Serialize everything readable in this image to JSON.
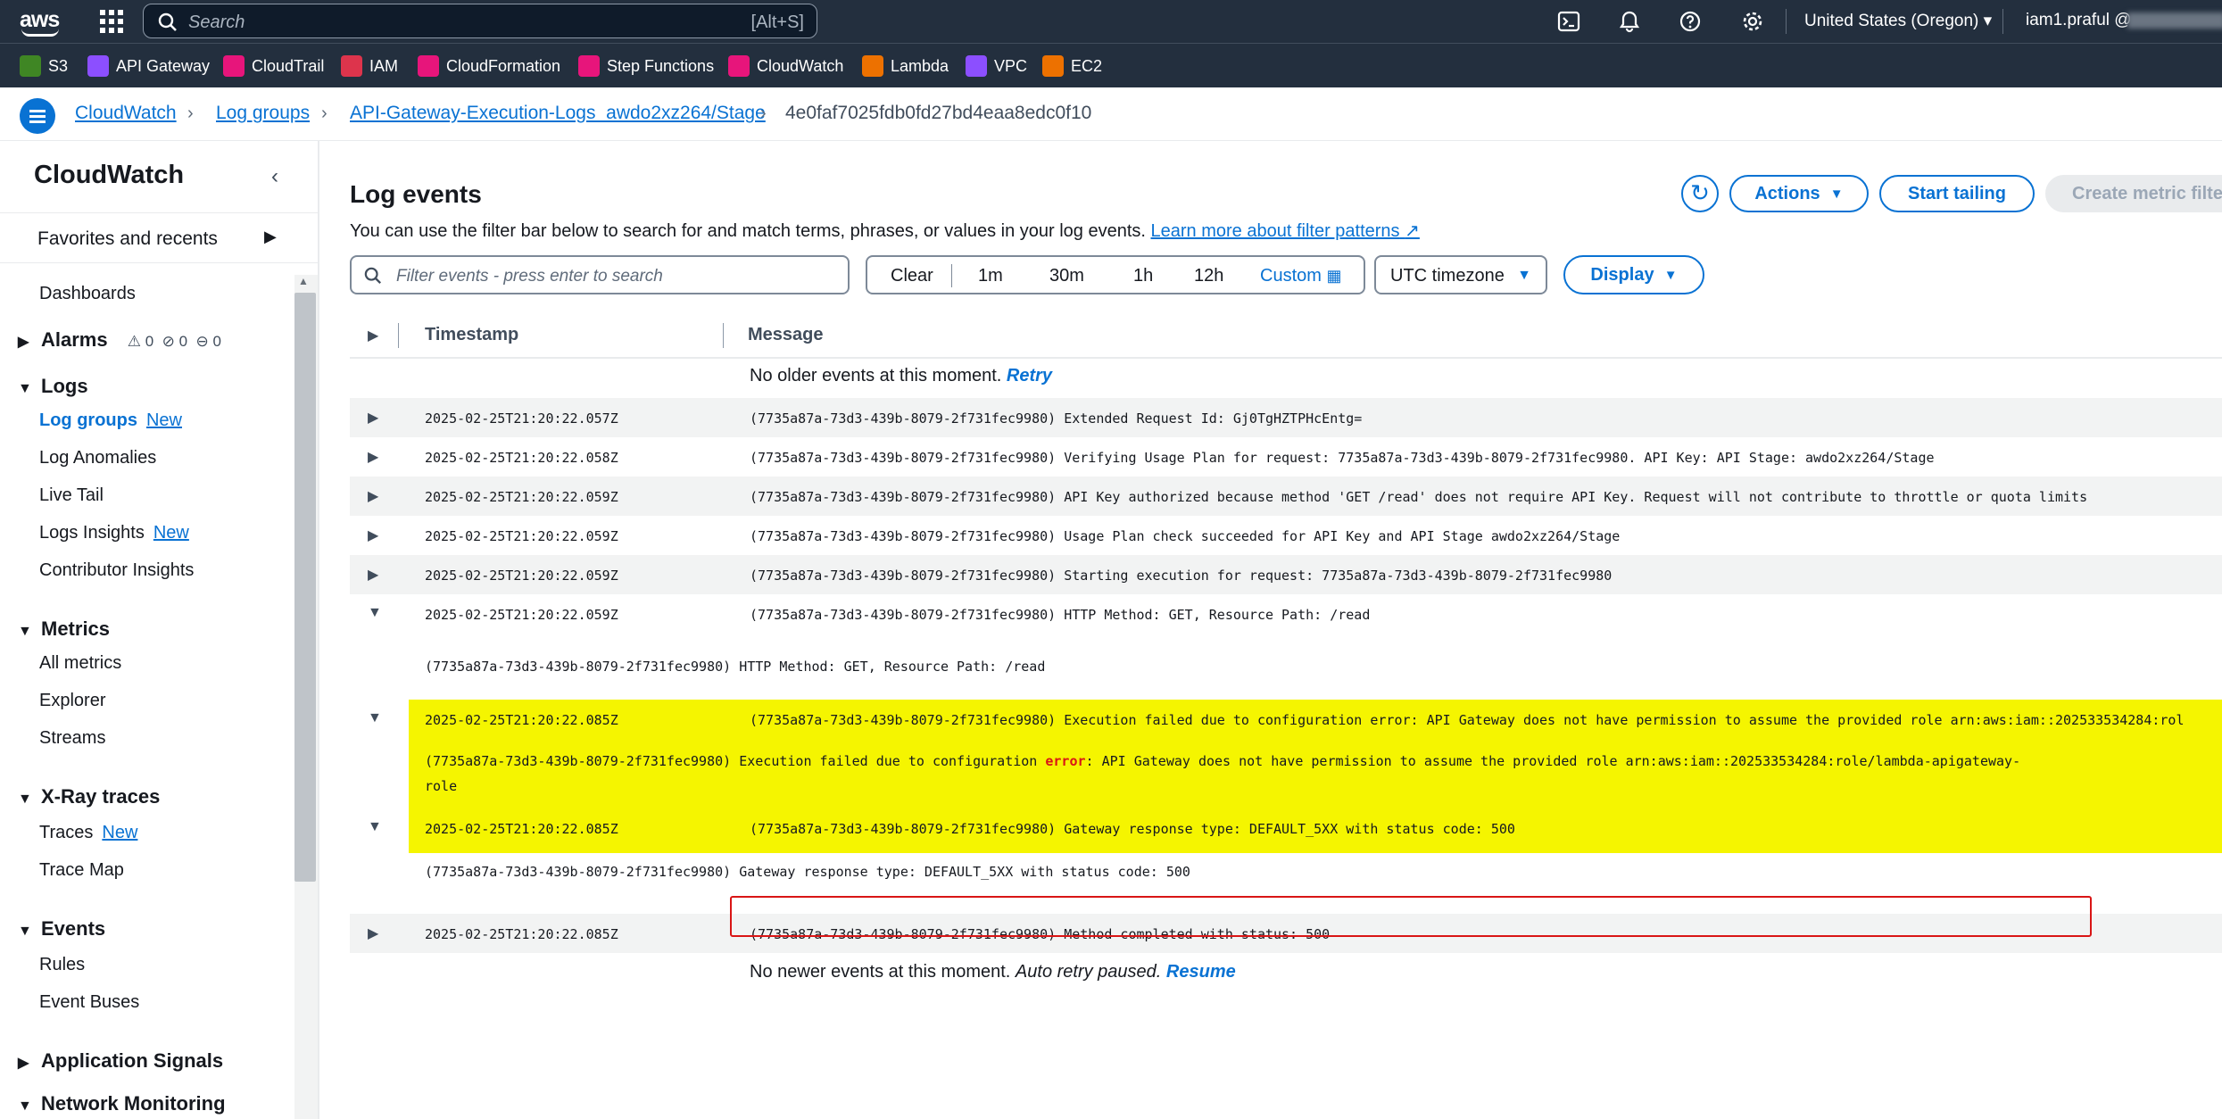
{
  "topbar": {
    "logo": "aws",
    "search_placeholder": "Search",
    "search_shortcut": "[Alt+S]",
    "region": "United States (Oregon) ▾",
    "account": "iam1.praful @",
    "icons": [
      "cloudshell-icon",
      "bell-icon",
      "help-icon",
      "settings-icon"
    ]
  },
  "favorites": [
    {
      "label": "S3",
      "color": "#3f8624"
    },
    {
      "label": "API Gateway",
      "color": "#8c4fff"
    },
    {
      "label": "CloudTrail",
      "color": "#e7157b"
    },
    {
      "label": "IAM",
      "color": "#dd344c"
    },
    {
      "label": "CloudFormation",
      "color": "#e7157b"
    },
    {
      "label": "Step Functions",
      "color": "#e7157b"
    },
    {
      "label": "CloudWatch",
      "color": "#e7157b"
    },
    {
      "label": "Lambda",
      "color": "#ed7100"
    },
    {
      "label": "VPC",
      "color": "#8c4fff"
    },
    {
      "label": "EC2",
      "color": "#ed7100"
    }
  ],
  "breadcrumb": {
    "items": [
      "CloudWatch",
      "Log groups",
      "API-Gateway-Execution-Logs_awdo2xz264/Stage"
    ],
    "current": "4e0faf7025fdb0fd27bd4eaa8edc0f10"
  },
  "sidebar": {
    "title": "CloudWatch",
    "favorites": "Favorites and recents",
    "dashboards": "Dashboards",
    "alarms": {
      "label": "Alarms",
      "in_alarm": "0",
      "ok": "0",
      "insufficient": "0"
    },
    "logs": {
      "label": "Logs",
      "items": [
        {
          "label": "Log groups",
          "new": "New"
        },
        {
          "label": "Log Anomalies"
        },
        {
          "label": "Live Tail"
        },
        {
          "label": "Logs Insights",
          "new": "New"
        },
        {
          "label": "Contributor Insights"
        }
      ]
    },
    "metrics": {
      "label": "Metrics",
      "items": [
        "All metrics",
        "Explorer",
        "Streams"
      ]
    },
    "xray": {
      "label": "X-Ray traces",
      "items": [
        {
          "label": "Traces",
          "new": "New"
        },
        {
          "label": "Trace Map"
        }
      ]
    },
    "events": {
      "label": "Events",
      "items": [
        "Rules",
        "Event Buses"
      ]
    },
    "app_signals": "Application Signals",
    "network": "Network Monitoring"
  },
  "main": {
    "title": "Log events",
    "description": "You can use the filter bar below to search for and match terms, phrases, or values in your log events.",
    "learn_more": "Learn more about filter patterns",
    "actions": "Actions",
    "start_tailing": "Start tailing",
    "create_metric": "Create metric filte",
    "filter_placeholder": "Filter events - press enter to search",
    "time_clear": "Clear",
    "time_options": [
      "1m",
      "30m",
      "1h",
      "12h"
    ],
    "time_custom": "Custom",
    "timezone": "UTC timezone",
    "display": "Display"
  },
  "table": {
    "col_timestamp": "Timestamp",
    "col_message": "Message",
    "older_note": "No older events at this moment.",
    "older_retry": "Retry",
    "newer_note": "No newer events at this moment.",
    "newer_auto": "Auto retry paused.",
    "newer_resume": "Resume",
    "rows": [
      {
        "ts": "2025-02-25T21:20:22.057Z",
        "msg": "(7735a87a-73d3-439b-8079-2f731fec9980) Extended Request Id: Gj0TgHZTPHcEntg="
      },
      {
        "ts": "2025-02-25T21:20:22.058Z",
        "msg": "(7735a87a-73d3-439b-8079-2f731fec9980) Verifying Usage Plan for request: 7735a87a-73d3-439b-8079-2f731fec9980. API Key: API Stage: awdo2xz264/Stage"
      },
      {
        "ts": "2025-02-25T21:20:22.059Z",
        "msg": "(7735a87a-73d3-439b-8079-2f731fec9980) API Key authorized because method 'GET /read' does not require API Key. Request will not contribute to throttle or quota limits"
      },
      {
        "ts": "2025-02-25T21:20:22.059Z",
        "msg": "(7735a87a-73d3-439b-8079-2f731fec9980) Usage Plan check succeeded for API Key and API Stage awdo2xz264/Stage"
      },
      {
        "ts": "2025-02-25T21:20:22.059Z",
        "msg": "(7735a87a-73d3-439b-8079-2f731fec9980) Starting execution for request: 7735a87a-73d3-439b-8079-2f731fec9980"
      },
      {
        "ts": "2025-02-25T21:20:22.059Z",
        "msg": "(7735a87a-73d3-439b-8079-2f731fec9980) HTTP Method: GET, Resource Path: /read",
        "detail": "(7735a87a-73d3-439b-8079-2f731fec9980) HTTP Method: GET, Resource Path: /read"
      },
      {
        "ts": "2025-02-25T21:20:22.085Z",
        "msg": "(7735a87a-73d3-439b-8079-2f731fec9980) Execution failed due to configuration error: API Gateway does not have permission to assume the provided role arn:aws:iam::202533534284:rol",
        "detail_a": "(7735a87a-73d3-439b-8079-2f731fec9980) Execution failed due to configuration ",
        "detail_err": "error",
        "detail_b": ": API Gateway does not have permission to assume the provided role arn:aws:iam::202533534284:role/lambda-apigateway-",
        "detail_c": "role"
      },
      {
        "ts": "2025-02-25T21:20:22.085Z",
        "msg": "(7735a87a-73d3-439b-8079-2f731fec9980) Gateway response type: DEFAULT_5XX with status code: 500",
        "detail": "(7735a87a-73d3-439b-8079-2f731fec9980) Gateway response type: DEFAULT_5XX with status code: 500"
      },
      {
        "ts": "2025-02-25T21:20:22.085Z",
        "msg": "(7735a87a-73d3-439b-8079-2f731fec9980) Method completed with status: 500"
      }
    ]
  },
  "colors": {
    "accent": "#0972d3",
    "topbar": "#232f3e",
    "highlight": "#f5f500",
    "error": "#d91515"
  }
}
